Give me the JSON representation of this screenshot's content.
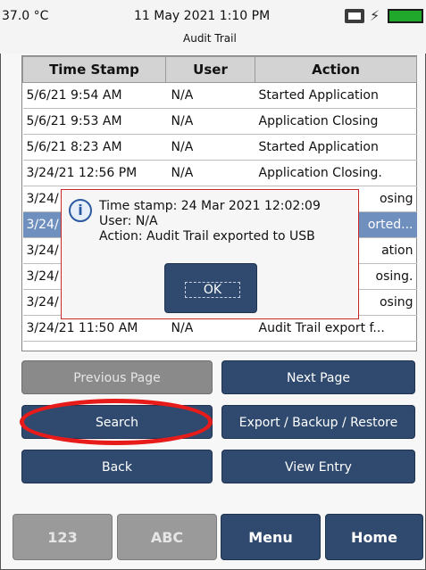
{
  "status": {
    "temperature": "37.0 °C",
    "datetime": "11 May 2021 1:10 PM",
    "title": "Audit Trail",
    "icons": [
      "network-icon",
      "power-plug-icon",
      "battery-icon"
    ]
  },
  "table": {
    "headers": [
      "Time Stamp",
      "User",
      "Action"
    ],
    "rows": [
      [
        "5/6/21 9:54 AM",
        "N/A",
        "Started Application"
      ],
      [
        "5/6/21 9:53 AM",
        "N/A",
        "Application Closing"
      ],
      [
        "5/6/21 8:23 AM",
        "N/A",
        "Started Application"
      ],
      [
        "3/24/21 12:56 PM",
        "N/A",
        "Application Closing."
      ],
      [
        "3/24/",
        "",
        "osing"
      ],
      [
        "3/24/",
        "",
        "orted..."
      ],
      [
        "3/24/",
        "",
        "ation"
      ],
      [
        "3/24/",
        "",
        "osing."
      ],
      [
        "3/24/",
        "",
        "osing"
      ],
      [
        "3/24/21 11:50 AM",
        "N/A",
        "Audit Trail export f..."
      ]
    ],
    "selected_row_index": 5
  },
  "dialog": {
    "line1": "Time stamp: 24 Mar 2021 12:02:09",
    "line2": "User: N/A",
    "line3": "Action: Audit Trail exported to USB",
    "ok_label": "OK"
  },
  "buttons": {
    "previous_page": "Previous Page",
    "next_page": "Next Page",
    "search": "Search",
    "export_backup_restore": "Export / Backup / Restore",
    "back": "Back",
    "view_entry": "View Entry"
  },
  "bottom_bar": {
    "num": "123",
    "abc": "ABC",
    "menu": "Menu",
    "home": "Home"
  },
  "colors": {
    "button_dark": "#2f4a6e",
    "button_disabled": "#8a8a8a",
    "selected_row": "#6f8fbf",
    "highlight_circle": "#e81b1b",
    "battery": "#1fa82b"
  }
}
